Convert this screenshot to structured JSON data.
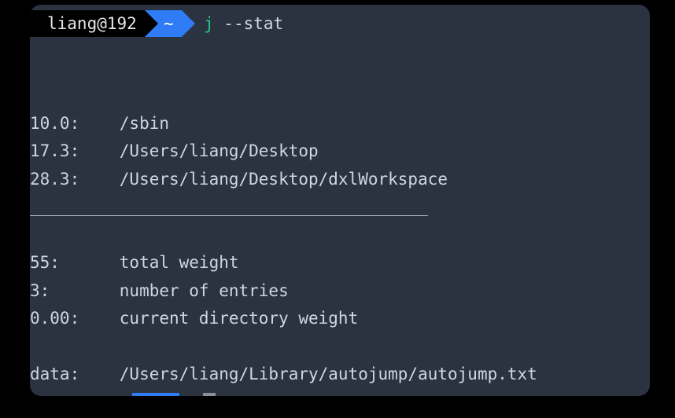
{
  "prompt": {
    "user_host": "liang@192",
    "cwd": "~",
    "command_name": "j",
    "command_args": " --stat"
  },
  "entries": [
    {
      "weight": "10.0:",
      "path": "/sbin"
    },
    {
      "weight": "17.3:",
      "path": "/Users/liang/Desktop"
    },
    {
      "weight": "28.3:",
      "path": "/Users/liang/Desktop/dxlWorkspace"
    }
  ],
  "separator": "________________________________________",
  "stats": [
    {
      "key": "55:",
      "label": "total weight"
    },
    {
      "key": "3:",
      "label": "number of entries"
    },
    {
      "key": "0.00:",
      "label": "current directory weight"
    }
  ],
  "data_row": {
    "key": "data:",
    "path": "/Users/liang/Library/autojump/autojump.txt"
  }
}
